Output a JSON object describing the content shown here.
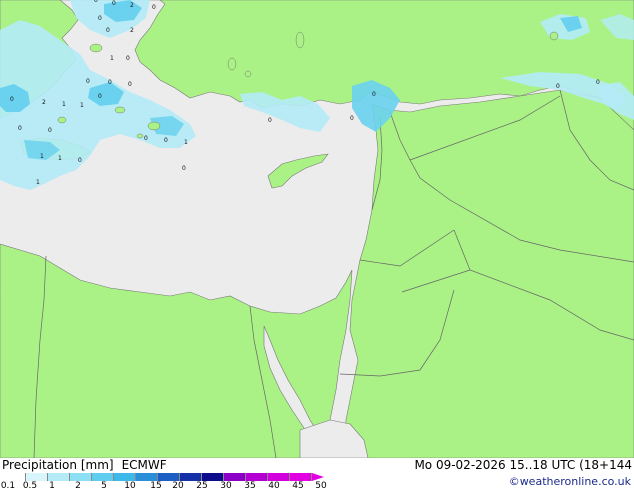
{
  "product": {
    "title": "Precipitation [mm]",
    "model": "ECMWF",
    "datetime": "Mo 09-02-2026 15..18 UTC (18+144",
    "credit": "©weatheronline.co.uk"
  },
  "colors": {
    "land": "#aaf285",
    "sea": "#ececec",
    "borders": "#666666",
    "precip_light": "#b4ebf7",
    "precip_medium": "#6ad2ef",
    "precip_heavy": "#2db4e6"
  },
  "legend": {
    "ticks": [
      "0.1",
      "0.5",
      "1",
      "2",
      "5",
      "10",
      "15",
      "20",
      "25",
      "30",
      "35",
      "40",
      "45",
      "50"
    ],
    "swatches": [
      "#ffffff",
      "#d8f5fb",
      "#b4ebf7",
      "#8ddff4",
      "#5fcdef",
      "#3cb9e9",
      "#2a8ed8",
      "#1d5ec4",
      "#1630a8",
      "#0c0c8c",
      "#8c00c8",
      "#b400d2",
      "#d200dc",
      "#e200e2"
    ]
  },
  "map_labels": [
    {
      "text": "0",
      "kind": "value"
    },
    {
      "text": "2",
      "kind": "value"
    },
    {
      "text": "1",
      "kind": "value"
    },
    {
      "text": "0",
      "kind": "value"
    },
    {
      "text": "0",
      "kind": "value"
    },
    {
      "text": "1",
      "kind": "value"
    },
    {
      "text": "2",
      "kind": "value"
    },
    {
      "text": "0",
      "kind": "value"
    },
    {
      "text": "0",
      "kind": "value"
    },
    {
      "text": "0",
      "kind": "value"
    },
    {
      "text": "0",
      "kind": "value"
    },
    {
      "text": "0",
      "kind": "value"
    },
    {
      "text": "0",
      "kind": "value"
    },
    {
      "text": "0",
      "kind": "value"
    },
    {
      "text": "1",
      "kind": "value"
    },
    {
      "text": "0",
      "kind": "value"
    },
    {
      "text": "0",
      "kind": "value"
    },
    {
      "text": "1",
      "kind": "value"
    },
    {
      "text": "1",
      "kind": "value"
    },
    {
      "text": "0",
      "kind": "value"
    },
    {
      "text": "0",
      "kind": "value"
    },
    {
      "text": "2",
      "kind": "value"
    },
    {
      "text": "0",
      "kind": "value"
    },
    {
      "text": "0",
      "kind": "value"
    },
    {
      "text": "1",
      "kind": "value"
    },
    {
      "text": "0",
      "kind": "value"
    },
    {
      "text": "1",
      "kind": "value"
    },
    {
      "text": "0",
      "kind": "value"
    },
    {
      "text": "0",
      "kind": "value"
    },
    {
      "text": "0",
      "kind": "value"
    },
    {
      "text": "0",
      "kind": "value"
    },
    {
      "text": "0",
      "kind": "value"
    }
  ]
}
